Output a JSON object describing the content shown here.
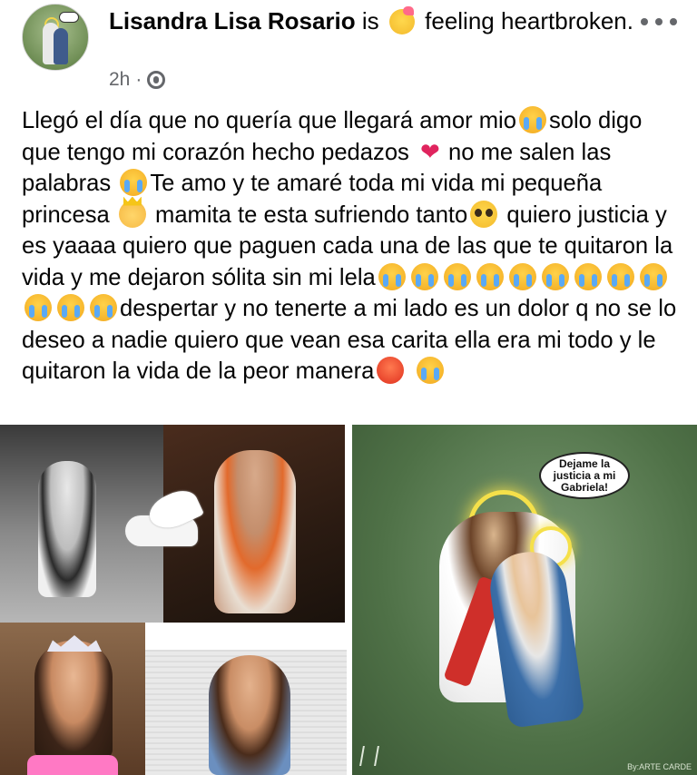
{
  "post": {
    "author": "Lisandra Lisa Rosario",
    "status_prefix": "is",
    "feeling": "feeling heartbroken.",
    "time": "2h",
    "separator": "·",
    "text_segments": [
      "Llegó el día que no quería que llegará amor mio",
      "solo digo que tengo mi corazón hecho pedazos",
      "no me salen las palabras",
      "Te amo y te amaré toda mi vida mi pequeña princesa",
      "mamita te esta sufriendo tanto",
      "quiero justicia y es yaaaa quiero que paguen cada una de las que te quitaron la vida y me dejaron sólita sin mi lela",
      "despertar y no tenerte a mi lado es un dolor q no se lo deseo a nadie quiero que vean esa carita ella era mi todo y le quitaron la vida de la peor manera"
    ]
  },
  "photos": {
    "illustration_bubble": "Dejame la justicia a mi Gabriela!",
    "illustration_credit": "By:ARTE CARDE"
  },
  "icons": [
    "more-options-icon",
    "globe-icon",
    "crying-emoji-icon",
    "broken-heart-emoji-icon",
    "crown-emoji-icon",
    "pleading-emoji-icon",
    "angry-emoji-icon",
    "heartbroken-emoji-icon"
  ],
  "colors": {
    "text": "#050505",
    "meta": "#65676b",
    "background": "#ffffff"
  }
}
